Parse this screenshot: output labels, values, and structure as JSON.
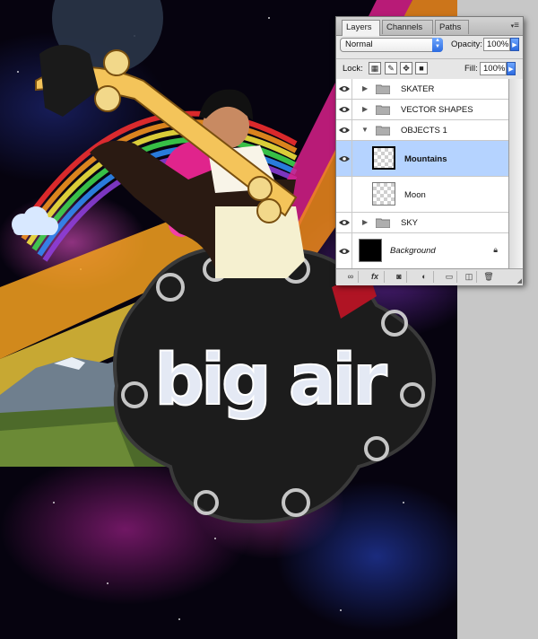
{
  "panel": {
    "tabs": [
      {
        "label": "Layers",
        "active": true
      },
      {
        "label": "Channels",
        "active": false
      },
      {
        "label": "Paths",
        "active": false
      }
    ],
    "blend_mode": "Normal",
    "opacity_label": "Opacity:",
    "opacity_value": "100%",
    "lock_label": "Lock:",
    "fill_label": "Fill:",
    "fill_value": "100%",
    "layers": [
      {
        "name": "SKATER",
        "type": "group",
        "expanded": false,
        "visible": true
      },
      {
        "name": "VECTOR SHAPES",
        "type": "group",
        "expanded": false,
        "visible": true
      },
      {
        "name": "OBJECTS 1",
        "type": "group",
        "expanded": true,
        "visible": true
      },
      {
        "name": "Mountains",
        "type": "layer",
        "selected": true,
        "visible": true
      },
      {
        "name": "Moon",
        "type": "layer",
        "selected": false,
        "visible": false
      },
      {
        "name": "SKY",
        "type": "group",
        "expanded": false,
        "visible": true
      },
      {
        "name": "Background",
        "type": "layer",
        "locked": true,
        "visible": true
      }
    ],
    "bottom_icons": [
      "link-icon",
      "fx-icon",
      "mask-icon",
      "adjustment-icon",
      "folder-icon",
      "new-layer-icon",
      "trash-icon"
    ],
    "fx_label": "fx",
    "colors": {
      "selection": "#b5d3ff",
      "accent_blue": "#2c6be0"
    }
  },
  "artwork": {
    "text": "big air"
  }
}
